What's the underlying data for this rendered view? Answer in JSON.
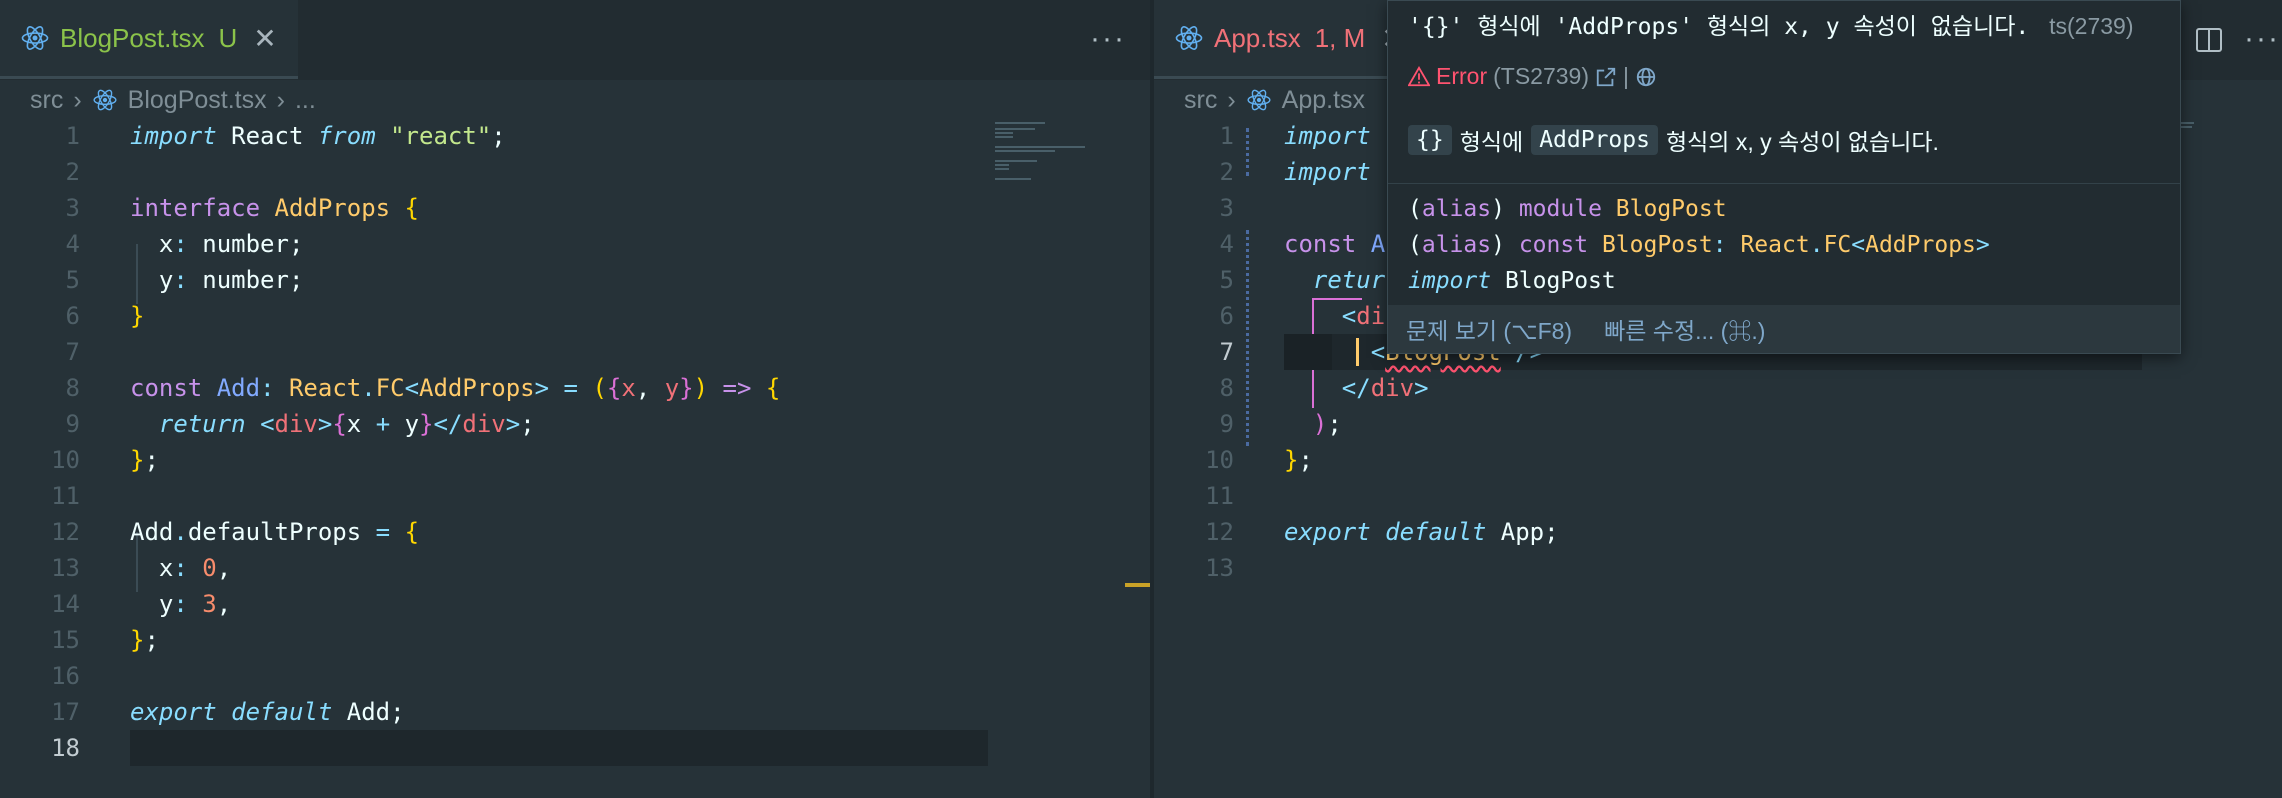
{
  "left": {
    "tab": {
      "title": "BlogPost.tsx",
      "badge": "U"
    },
    "breadcrumb": [
      "src",
      "BlogPost.tsx",
      "..."
    ],
    "current_line": "18"
  },
  "right": {
    "tab": {
      "title": "App.tsx",
      "badge": "1, M"
    },
    "breadcrumb": [
      "src",
      "App.tsx"
    ],
    "current_line": "7"
  },
  "hover": {
    "header_message": "'{}' 형식에 'AddProps' 형식의 x, y 속성이 없습니다.",
    "header_code": "ts(2739)",
    "error_label": "Error",
    "error_code": "(TS2739)",
    "separator": "|",
    "detail_chip1": "{}",
    "detail_text1": "형식에",
    "detail_chip2": "AddProps",
    "detail_text2": "형식의 x, y 속성이 없습니다.",
    "sig1_open": "(",
    "sig1_kw": "alias",
    "sig1_close": ")",
    "sig1_module": "module",
    "sig1_name": "BlogPost",
    "sig2_open": "(",
    "sig2_kw": "alias",
    "sig2_close": ")",
    "sig2_const": "const",
    "sig2_name": "BlogPost",
    "sig2_colon": ":",
    "sig2_react": "React",
    "sig2_dot": ".",
    "sig2_fc": "FC",
    "sig2_lt": "<",
    "sig2_type": "AddProps",
    "sig2_gt": ">",
    "sig3_import": "import",
    "sig3_name": "BlogPost",
    "action_view_problem": "문제 보기 (⌥F8)",
    "action_quick_fix": "빠른 수정... (⌘.)"
  },
  "icons": {
    "react": "react-icon",
    "close": "close-icon",
    "more": "more-actions-icon",
    "split": "split-editor-icon",
    "warning": "warning-icon",
    "external": "external-link-icon",
    "globe": "globe-icon"
  },
  "colors": {
    "background": "#263238",
    "keyword": "#c792ea",
    "type": "#ffcb6b",
    "string": "#c3e88d",
    "number": "#f78c6c",
    "error": "#ff5370",
    "untracked": "#8bc34a",
    "modified": "#f07178"
  }
}
